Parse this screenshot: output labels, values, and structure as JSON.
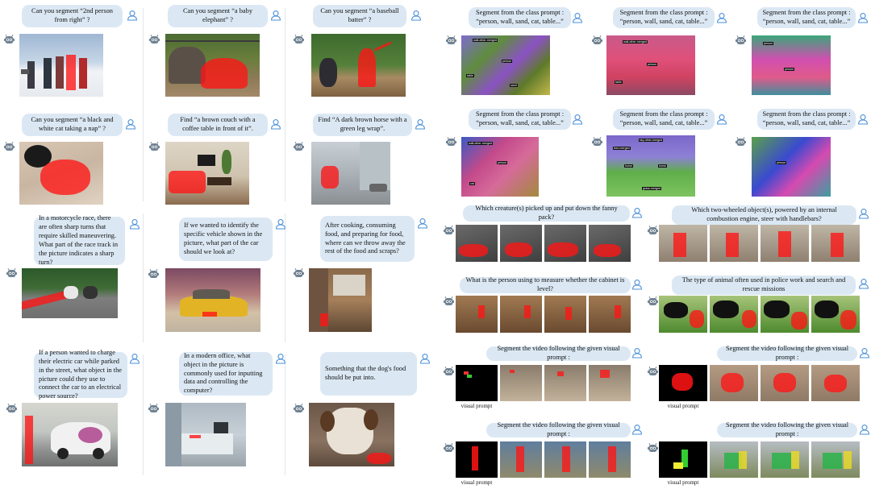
{
  "left_panel": {
    "prompts": [
      "Can you segment “2nd person from right” ?",
      "Can you segment “a baby elephant” ?",
      "Can you segment “a baseball batter” ?",
      "Can you segment “a black and white cat taking a nap” ?",
      "Find “a brown couch with a coffee table in front of it”.",
      "Find “A dark brown horse with a green leg wrap”.",
      "In a motorcycle race, there are often sharp turns that require skilled maneuvering. What part of the race track in the picture indicates a sharp turn?",
      "If we wanted to identify the specific vehicle shown in the picture, what part of the car should we look at?",
      "After cooking, consuming food, and preparing for food, where can we throw away the rest of the food and scraps?",
      "If a person wanted to charge their electric car while parked in the street, what object in the picture could they use to connect the car to an electrical power source?",
      "In a modern office, what object in the picture is commonly used for inputting data and controlling the computer?",
      "Something that the dog's food should be put into."
    ]
  },
  "right_panel": {
    "class_prompt": "Segment from the class prompt : “person, wall, sand, cat, table...”",
    "panoptic_labels": [
      "wall-other-merged",
      "person",
      "sand",
      "cat",
      "table",
      "tree-merged",
      "sky-other-merged",
      "horse",
      "grass-merged",
      "dirt-merged"
    ],
    "video_prompts": [
      "Which creature(s) picked up and put down the fanny pack?",
      "Which two-wheeled object(s), powered by an internal combustion engine, steer with handlebars?",
      "What is the person using to measure whether the cabinet is level?",
      "The type of animal often used in police work and search and rescue missions"
    ],
    "visual_prompt_instruction": "Segment the video following the given visual prompt :",
    "visual_prompt_caption": "visual prompt"
  },
  "colors": {
    "bubble": "#dbe8f4",
    "mask_red": "#ff1414",
    "user_icon": "#4a90d9"
  },
  "icons": {
    "user": "user-outline-icon",
    "assistant": "robot-head-icon"
  }
}
